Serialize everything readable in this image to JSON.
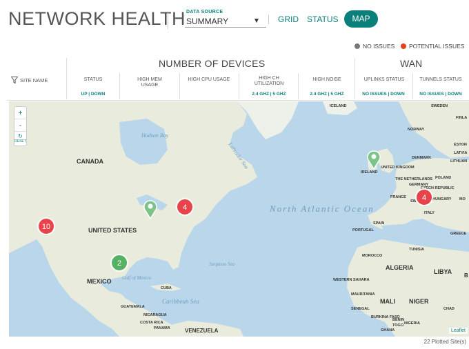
{
  "header": {
    "title": "NETWORK HEALTH",
    "data_source_label": "DATA SOURCE",
    "data_source_value": "SUMMARY",
    "tabs": [
      {
        "label": "GRID",
        "active": false
      },
      {
        "label": "STATUS",
        "active": false
      },
      {
        "label": "MAP",
        "active": true
      }
    ]
  },
  "legend": {
    "no_issues": {
      "label": "NO ISSUES",
      "color": "#777777"
    },
    "potential_issues": {
      "label": "POTENTIAL ISSUES",
      "color": "#e8401c"
    }
  },
  "table_header": {
    "site_name": "SITE NAME",
    "group_devices": "NUMBER OF DEVICES",
    "group_wan": "WAN",
    "columns": [
      {
        "label": "STATUS",
        "sub": [
          "UP",
          "DOWN"
        ]
      },
      {
        "label": "HIGH MEM USAGE",
        "sub": []
      },
      {
        "label": "HIGH CPU USAGE",
        "sub": []
      },
      {
        "label": "HIGH CH UTILIZATION",
        "sub": [
          "2.4 GHZ",
          "5 GHZ"
        ]
      },
      {
        "label": "HIGH NOISE",
        "sub": [
          "2.4 GHZ",
          "5 GHZ"
        ]
      },
      {
        "label": "UPLINKS STATUS",
        "sub": [
          "NO ISSUES",
          "DOWN"
        ]
      },
      {
        "label": "TUNNELS STATUS",
        "sub": [
          "NO ISSUES",
          "DOWN"
        ]
      }
    ]
  },
  "map": {
    "zoom_in": "+",
    "zoom_out": "-",
    "reset": "RESET",
    "attribution": "Leaflet",
    "labels": {
      "canada": "CANADA",
      "united_states": "UNITED STATES",
      "mexico": "MEXICO",
      "cuba": "CUBA",
      "guatemala": "GUATEMALA",
      "nicaragua": "NICARAGUA",
      "costa_rica": "COSTA RICA",
      "panama": "PANAMA",
      "venezuela": "VENEZUELA",
      "iceland": "ICELAND",
      "sweden": "SWEDEN",
      "finland": "FINLA",
      "norway": "NORWAY",
      "estonia": "ESTON",
      "latvia": "LATVIA",
      "lithuania": "LITHUAN",
      "denmark": "DENMARK",
      "united_kingdom": "UNITED KINGDOM",
      "ireland": "IRELAND",
      "netherlands": "THE NETHERLANDS",
      "poland": "POLAND",
      "germany": "GERMANY",
      "czech": "CZECH REPUBLIC",
      "france": "FRANCE",
      "switzerland": "SWITZ",
      "hungary": "HUNGARY",
      "romania": "MO",
      "italy": "ITALY",
      "spain": "SPAIN",
      "portugal": "PORTUGAL",
      "greece": "GREECE",
      "morocco": "MOROCCO",
      "tunisia": "TUNISIA",
      "algeria": "ALGERIA",
      "libya": "LIBYA",
      "western_sahara": "WESTERN SAHARA",
      "mauritania": "MAURITANIA",
      "mali": "MALI",
      "niger": "NIGER",
      "senegal": "SENEGAL",
      "burkina": "BURKINA FASO",
      "benin": "BENIN",
      "nigeria": "NIGERIA",
      "ghana": "GHANA",
      "chad": "CHAD",
      "togo": "TOGO",
      "b": "B",
      "hudson_bay": "Hudson Bay",
      "labrador_sea": "Labrador Sea",
      "north_atlantic": "North Atlantic Ocean",
      "gulf_of_mexico": "Gulf of Mexico",
      "sargasso_sea": "Sargasso Sea",
      "caribbean_sea": "Caribbean Sea"
    },
    "clusters": [
      {
        "name": "california",
        "count": "10",
        "color": "#e8434a"
      },
      {
        "name": "northeast",
        "count": "4",
        "color": "#e8434a"
      },
      {
        "name": "texas",
        "count": "2",
        "color": "#56b163"
      },
      {
        "name": "europe",
        "count": "4",
        "color": "#e8434a"
      }
    ],
    "pins": [
      {
        "name": "midwest",
        "color": "#7cc48a"
      },
      {
        "name": "ireland",
        "color": "#7cc48a"
      }
    ]
  },
  "footer": {
    "plotted": "22 Plotted Site(s)"
  }
}
